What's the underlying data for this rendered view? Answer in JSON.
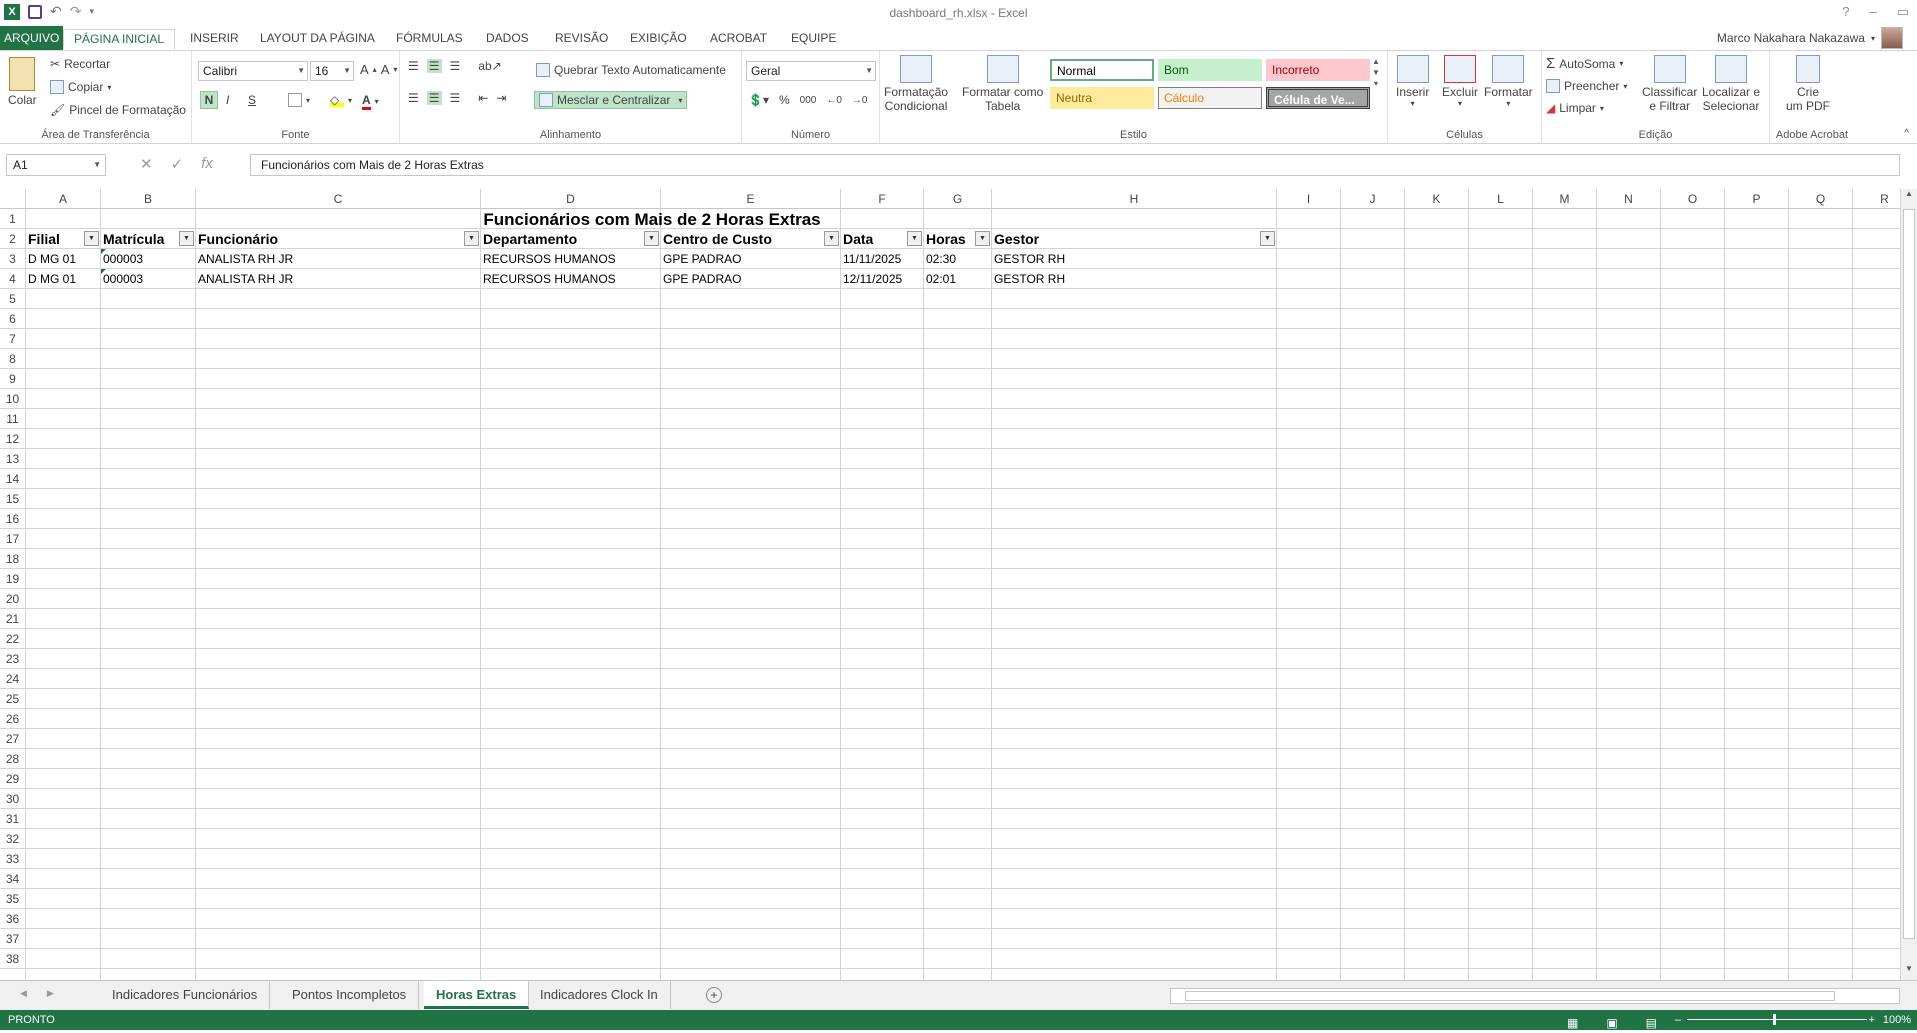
{
  "window": {
    "title": "dashboard_rh.xlsx - Excel",
    "help": "?",
    "restore": "▭",
    "minimize": "–"
  },
  "user": {
    "name": "Marco Nakahara Nakazawa"
  },
  "tabs": [
    "ARQUIVO",
    "PÁGINA INICIAL",
    "INSERIR",
    "LAYOUT DA PÁGINA",
    "FÓRMULAS",
    "DADOS",
    "REVISÃO",
    "EXIBIÇÃO",
    "ACROBAT",
    "EQUIPE"
  ],
  "ribbon": {
    "clipboard": {
      "paste": "Colar",
      "cut": "Recortar",
      "copy": "Copiar",
      "format_painter": "Pincel de Formatação",
      "label": "Área de Transferência"
    },
    "font": {
      "name": "Calibri",
      "size": "16",
      "bold": "N",
      "italic": "I",
      "underline": "S",
      "label": "Fonte"
    },
    "alignment": {
      "wrap": "Quebrar Texto Automaticamente",
      "merge": "Mesclar e Centralizar",
      "label": "Alinhamento"
    },
    "number": {
      "format": "Geral",
      "percent": "%",
      "thousands": "000",
      "label": "Número"
    },
    "styles": {
      "conditional_l1": "Formatação",
      "conditional_l2": "Condicional",
      "table_l1": "Formatar como",
      "table_l2": "Tabela",
      "normal": "Normal",
      "good": "Bom",
      "bad": "Incorreto",
      "neutral": "Neutra",
      "calc": "Cálculo",
      "check": "Célula de Ve...",
      "label": "Estilo"
    },
    "cells": {
      "insert": "Inserir",
      "delete": "Excluir",
      "format": "Formatar",
      "label": "Células"
    },
    "editing": {
      "autosum": "AutoSoma",
      "fill": "Preencher",
      "clear": "Limpar",
      "sort_l1": "Classificar",
      "sort_l2": "e Filtrar",
      "find_l1": "Localizar e",
      "find_l2": "Selecionar",
      "label": "Edição"
    },
    "acrobat": {
      "create_l1": "Crie",
      "create_l2": "um PDF",
      "label": "Adobe Acrobat"
    }
  },
  "formula_bar": {
    "name_box": "A1",
    "fx": "fx",
    "content": "Funcionários com Mais de 2 Horas Extras"
  },
  "sheet": {
    "columns": [
      "A",
      "B",
      "C",
      "D",
      "E",
      "F",
      "G",
      "H",
      "I",
      "J",
      "K",
      "L",
      "M",
      "N",
      "O",
      "P",
      "Q",
      "R"
    ],
    "title": "Funcionários com Mais de 2 Horas Extras",
    "headers": [
      "Filial",
      "Matrícula",
      "Funcionário",
      "Departamento",
      "Centro de Custo",
      "Data",
      "Horas",
      "Gestor"
    ],
    "rows": [
      [
        "D MG 01",
        "000003",
        "ANALISTA RH JR",
        "RECURSOS HUMANOS",
        "GPE PADRAO",
        "11/11/2025",
        "02:30",
        "GESTOR RH"
      ],
      [
        "D MG 01",
        "000003",
        "ANALISTA RH JR",
        "RECURSOS HUMANOS",
        "GPE PADRAO",
        "12/11/2025",
        "02:01",
        "GESTOR RH"
      ]
    ],
    "row_count": 38
  },
  "sheet_tabs": [
    "Indicadores Funcionários",
    "Pontos Incompletos",
    "Horas Extras",
    "Indicadores Clock In"
  ],
  "active_sheet": "Horas Extras",
  "status": {
    "mode": "PRONTO",
    "zoom": "100%"
  },
  "colors": {
    "accent": "#217346"
  }
}
